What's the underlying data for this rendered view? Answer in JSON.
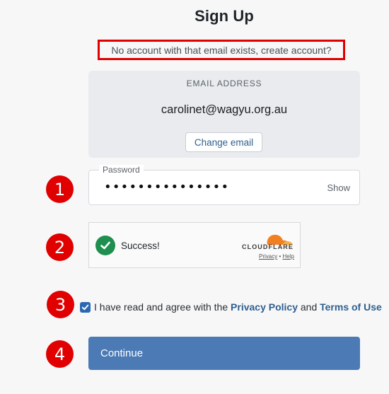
{
  "title": "Sign Up",
  "notice": "No account with that email exists, create account?",
  "email_card": {
    "label": "EMAIL ADDRESS",
    "value": "carolinet@wagyu.org.au",
    "change_button": "Change email"
  },
  "password": {
    "label": "Password",
    "masked_value": "•••••••••••••••",
    "show_label": "Show"
  },
  "captcha": {
    "status": "Success!",
    "brand": "CLOUDFLARE",
    "privacy_link": "Privacy",
    "separator": "•",
    "help_link": "Help"
  },
  "agree": {
    "checked": true,
    "prefix": "I have read and agree with the",
    "privacy_link": "Privacy Policy",
    "and": "and",
    "terms_link": "Terms of Use"
  },
  "continue_button": "Continue",
  "markers": [
    "1",
    "2",
    "3",
    "4"
  ],
  "colors": {
    "accent": "#4b7ab5",
    "link": "#2f5f8f",
    "marker": "#e00000",
    "success": "#1e8f4e",
    "cloudflare_orange": "#f38020"
  }
}
